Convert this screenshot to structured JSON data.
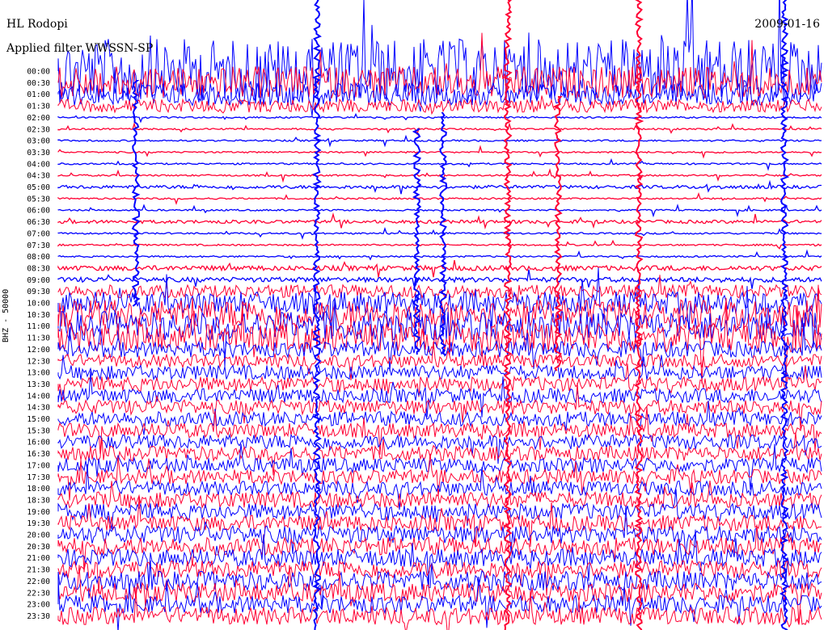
{
  "header": {
    "station": "HL Rodopi",
    "filter": "Applied filter WWSSN-SP",
    "date": "2009-01-16",
    "channel": "BHZ - 50000"
  },
  "colors": {
    "trace_a": "#0000ff",
    "trace_b": "#ff0033"
  },
  "chart_data": {
    "type": "line",
    "title": "HL Rodopi",
    "subtitle": "Applied filter WWSSN-SP",
    "date": "2009-01-16",
    "ylabel": "BHZ - 50000",
    "rows": [
      {
        "label": "00:00",
        "color": "blue",
        "amp": 40
      },
      {
        "label": "00:30",
        "color": "red",
        "amp": 20
      },
      {
        "label": "01:00",
        "color": "blue",
        "amp": 14
      },
      {
        "label": "01:30",
        "color": "red",
        "amp": 8
      },
      {
        "label": "02:00",
        "color": "blue",
        "amp": 1
      },
      {
        "label": "02:30",
        "color": "red",
        "amp": 1
      },
      {
        "label": "03:00",
        "color": "blue",
        "amp": 1
      },
      {
        "label": "03:30",
        "color": "red",
        "amp": 1
      },
      {
        "label": "04:00",
        "color": "blue",
        "amp": 1
      },
      {
        "label": "04:30",
        "color": "red",
        "amp": 1
      },
      {
        "label": "05:00",
        "color": "blue",
        "amp": 2
      },
      {
        "label": "05:30",
        "color": "red",
        "amp": 1
      },
      {
        "label": "06:00",
        "color": "blue",
        "amp": 1
      },
      {
        "label": "06:30",
        "color": "red",
        "amp": 2
      },
      {
        "label": "07:00",
        "color": "blue",
        "amp": 1
      },
      {
        "label": "07:30",
        "color": "red",
        "amp": 1
      },
      {
        "label": "08:00",
        "color": "blue",
        "amp": 1
      },
      {
        "label": "08:30",
        "color": "red",
        "amp": 3
      },
      {
        "label": "09:00",
        "color": "blue",
        "amp": 3
      },
      {
        "label": "09:30",
        "color": "red",
        "amp": 8
      },
      {
        "label": "10:00",
        "color": "blue",
        "amp": 14
      },
      {
        "label": "10:30",
        "color": "red",
        "amp": 18
      },
      {
        "label": "11:00",
        "color": "blue",
        "amp": 18
      },
      {
        "label": "11:30",
        "color": "red",
        "amp": 18
      },
      {
        "label": "12:00",
        "color": "blue",
        "amp": 10
      },
      {
        "label": "12:30",
        "color": "red",
        "amp": 8
      },
      {
        "label": "13:00",
        "color": "blue",
        "amp": 9
      },
      {
        "label": "13:30",
        "color": "red",
        "amp": 9
      },
      {
        "label": "14:00",
        "color": "blue",
        "amp": 9
      },
      {
        "label": "14:30",
        "color": "red",
        "amp": 9
      },
      {
        "label": "15:00",
        "color": "blue",
        "amp": 9
      },
      {
        "label": "15:30",
        "color": "red",
        "amp": 9
      },
      {
        "label": "16:00",
        "color": "blue",
        "amp": 9
      },
      {
        "label": "16:30",
        "color": "red",
        "amp": 9
      },
      {
        "label": "17:00",
        "color": "blue",
        "amp": 9
      },
      {
        "label": "17:30",
        "color": "red",
        "amp": 9
      },
      {
        "label": "18:00",
        "color": "blue",
        "amp": 9
      },
      {
        "label": "18:30",
        "color": "red",
        "amp": 10
      },
      {
        "label": "19:00",
        "color": "blue",
        "amp": 10
      },
      {
        "label": "19:30",
        "color": "red",
        "amp": 10
      },
      {
        "label": "20:00",
        "color": "blue",
        "amp": 11
      },
      {
        "label": "20:30",
        "color": "red",
        "amp": 11
      },
      {
        "label": "21:00",
        "color": "blue",
        "amp": 11
      },
      {
        "label": "21:30",
        "color": "red",
        "amp": 11
      },
      {
        "label": "22:00",
        "color": "blue",
        "amp": 12
      },
      {
        "label": "22:30",
        "color": "red",
        "amp": 12
      },
      {
        "label": "23:00",
        "color": "blue",
        "amp": 11
      },
      {
        "label": "23:30",
        "color": "red",
        "amp": 11
      }
    ]
  }
}
